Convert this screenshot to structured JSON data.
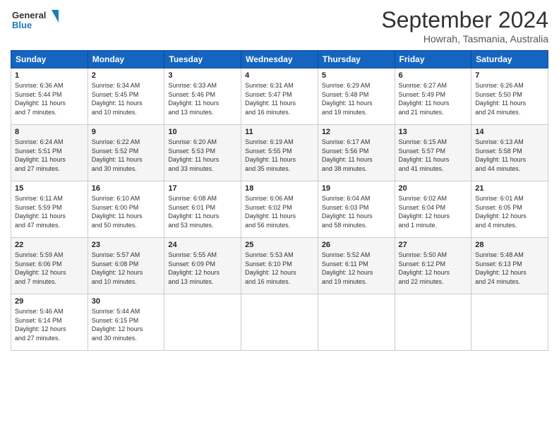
{
  "header": {
    "logo_line1": "General",
    "logo_line2": "Blue",
    "month_year": "September 2024",
    "location": "Howrah, Tasmania, Australia"
  },
  "weekdays": [
    "Sunday",
    "Monday",
    "Tuesday",
    "Wednesday",
    "Thursday",
    "Friday",
    "Saturday"
  ],
  "weeks": [
    [
      {
        "day": "1",
        "info": "Sunrise: 6:36 AM\nSunset: 5:44 PM\nDaylight: 11 hours\nand 7 minutes."
      },
      {
        "day": "2",
        "info": "Sunrise: 6:34 AM\nSunset: 5:45 PM\nDaylight: 11 hours\nand 10 minutes."
      },
      {
        "day": "3",
        "info": "Sunrise: 6:33 AM\nSunset: 5:46 PM\nDaylight: 11 hours\nand 13 minutes."
      },
      {
        "day": "4",
        "info": "Sunrise: 6:31 AM\nSunset: 5:47 PM\nDaylight: 11 hours\nand 16 minutes."
      },
      {
        "day": "5",
        "info": "Sunrise: 6:29 AM\nSunset: 5:48 PM\nDaylight: 11 hours\nand 19 minutes."
      },
      {
        "day": "6",
        "info": "Sunrise: 6:27 AM\nSunset: 5:49 PM\nDaylight: 11 hours\nand 21 minutes."
      },
      {
        "day": "7",
        "info": "Sunrise: 6:26 AM\nSunset: 5:50 PM\nDaylight: 11 hours\nand 24 minutes."
      }
    ],
    [
      {
        "day": "8",
        "info": "Sunrise: 6:24 AM\nSunset: 5:51 PM\nDaylight: 11 hours\nand 27 minutes."
      },
      {
        "day": "9",
        "info": "Sunrise: 6:22 AM\nSunset: 5:52 PM\nDaylight: 11 hours\nand 30 minutes."
      },
      {
        "day": "10",
        "info": "Sunrise: 6:20 AM\nSunset: 5:53 PM\nDaylight: 11 hours\nand 33 minutes."
      },
      {
        "day": "11",
        "info": "Sunrise: 6:19 AM\nSunset: 5:55 PM\nDaylight: 11 hours\nand 35 minutes."
      },
      {
        "day": "12",
        "info": "Sunrise: 6:17 AM\nSunset: 5:56 PM\nDaylight: 11 hours\nand 38 minutes."
      },
      {
        "day": "13",
        "info": "Sunrise: 6:15 AM\nSunset: 5:57 PM\nDaylight: 11 hours\nand 41 minutes."
      },
      {
        "day": "14",
        "info": "Sunrise: 6:13 AM\nSunset: 5:58 PM\nDaylight: 11 hours\nand 44 minutes."
      }
    ],
    [
      {
        "day": "15",
        "info": "Sunrise: 6:11 AM\nSunset: 5:59 PM\nDaylight: 11 hours\nand 47 minutes."
      },
      {
        "day": "16",
        "info": "Sunrise: 6:10 AM\nSunset: 6:00 PM\nDaylight: 11 hours\nand 50 minutes."
      },
      {
        "day": "17",
        "info": "Sunrise: 6:08 AM\nSunset: 6:01 PM\nDaylight: 11 hours\nand 53 minutes."
      },
      {
        "day": "18",
        "info": "Sunrise: 6:06 AM\nSunset: 6:02 PM\nDaylight: 11 hours\nand 56 minutes."
      },
      {
        "day": "19",
        "info": "Sunrise: 6:04 AM\nSunset: 6:03 PM\nDaylight: 11 hours\nand 58 minutes."
      },
      {
        "day": "20",
        "info": "Sunrise: 6:02 AM\nSunset: 6:04 PM\nDaylight: 12 hours\nand 1 minute."
      },
      {
        "day": "21",
        "info": "Sunrise: 6:01 AM\nSunset: 6:05 PM\nDaylight: 12 hours\nand 4 minutes."
      }
    ],
    [
      {
        "day": "22",
        "info": "Sunrise: 5:59 AM\nSunset: 6:06 PM\nDaylight: 12 hours\nand 7 minutes."
      },
      {
        "day": "23",
        "info": "Sunrise: 5:57 AM\nSunset: 6:08 PM\nDaylight: 12 hours\nand 10 minutes."
      },
      {
        "day": "24",
        "info": "Sunrise: 5:55 AM\nSunset: 6:09 PM\nDaylight: 12 hours\nand 13 minutes."
      },
      {
        "day": "25",
        "info": "Sunrise: 5:53 AM\nSunset: 6:10 PM\nDaylight: 12 hours\nand 16 minutes."
      },
      {
        "day": "26",
        "info": "Sunrise: 5:52 AM\nSunset: 6:11 PM\nDaylight: 12 hours\nand 19 minutes."
      },
      {
        "day": "27",
        "info": "Sunrise: 5:50 AM\nSunset: 6:12 PM\nDaylight: 12 hours\nand 22 minutes."
      },
      {
        "day": "28",
        "info": "Sunrise: 5:48 AM\nSunset: 6:13 PM\nDaylight: 12 hours\nand 24 minutes."
      }
    ],
    [
      {
        "day": "29",
        "info": "Sunrise: 5:46 AM\nSunset: 6:14 PM\nDaylight: 12 hours\nand 27 minutes."
      },
      {
        "day": "30",
        "info": "Sunrise: 5:44 AM\nSunset: 6:15 PM\nDaylight: 12 hours\nand 30 minutes."
      },
      {
        "day": "",
        "info": ""
      },
      {
        "day": "",
        "info": ""
      },
      {
        "day": "",
        "info": ""
      },
      {
        "day": "",
        "info": ""
      },
      {
        "day": "",
        "info": ""
      }
    ]
  ]
}
